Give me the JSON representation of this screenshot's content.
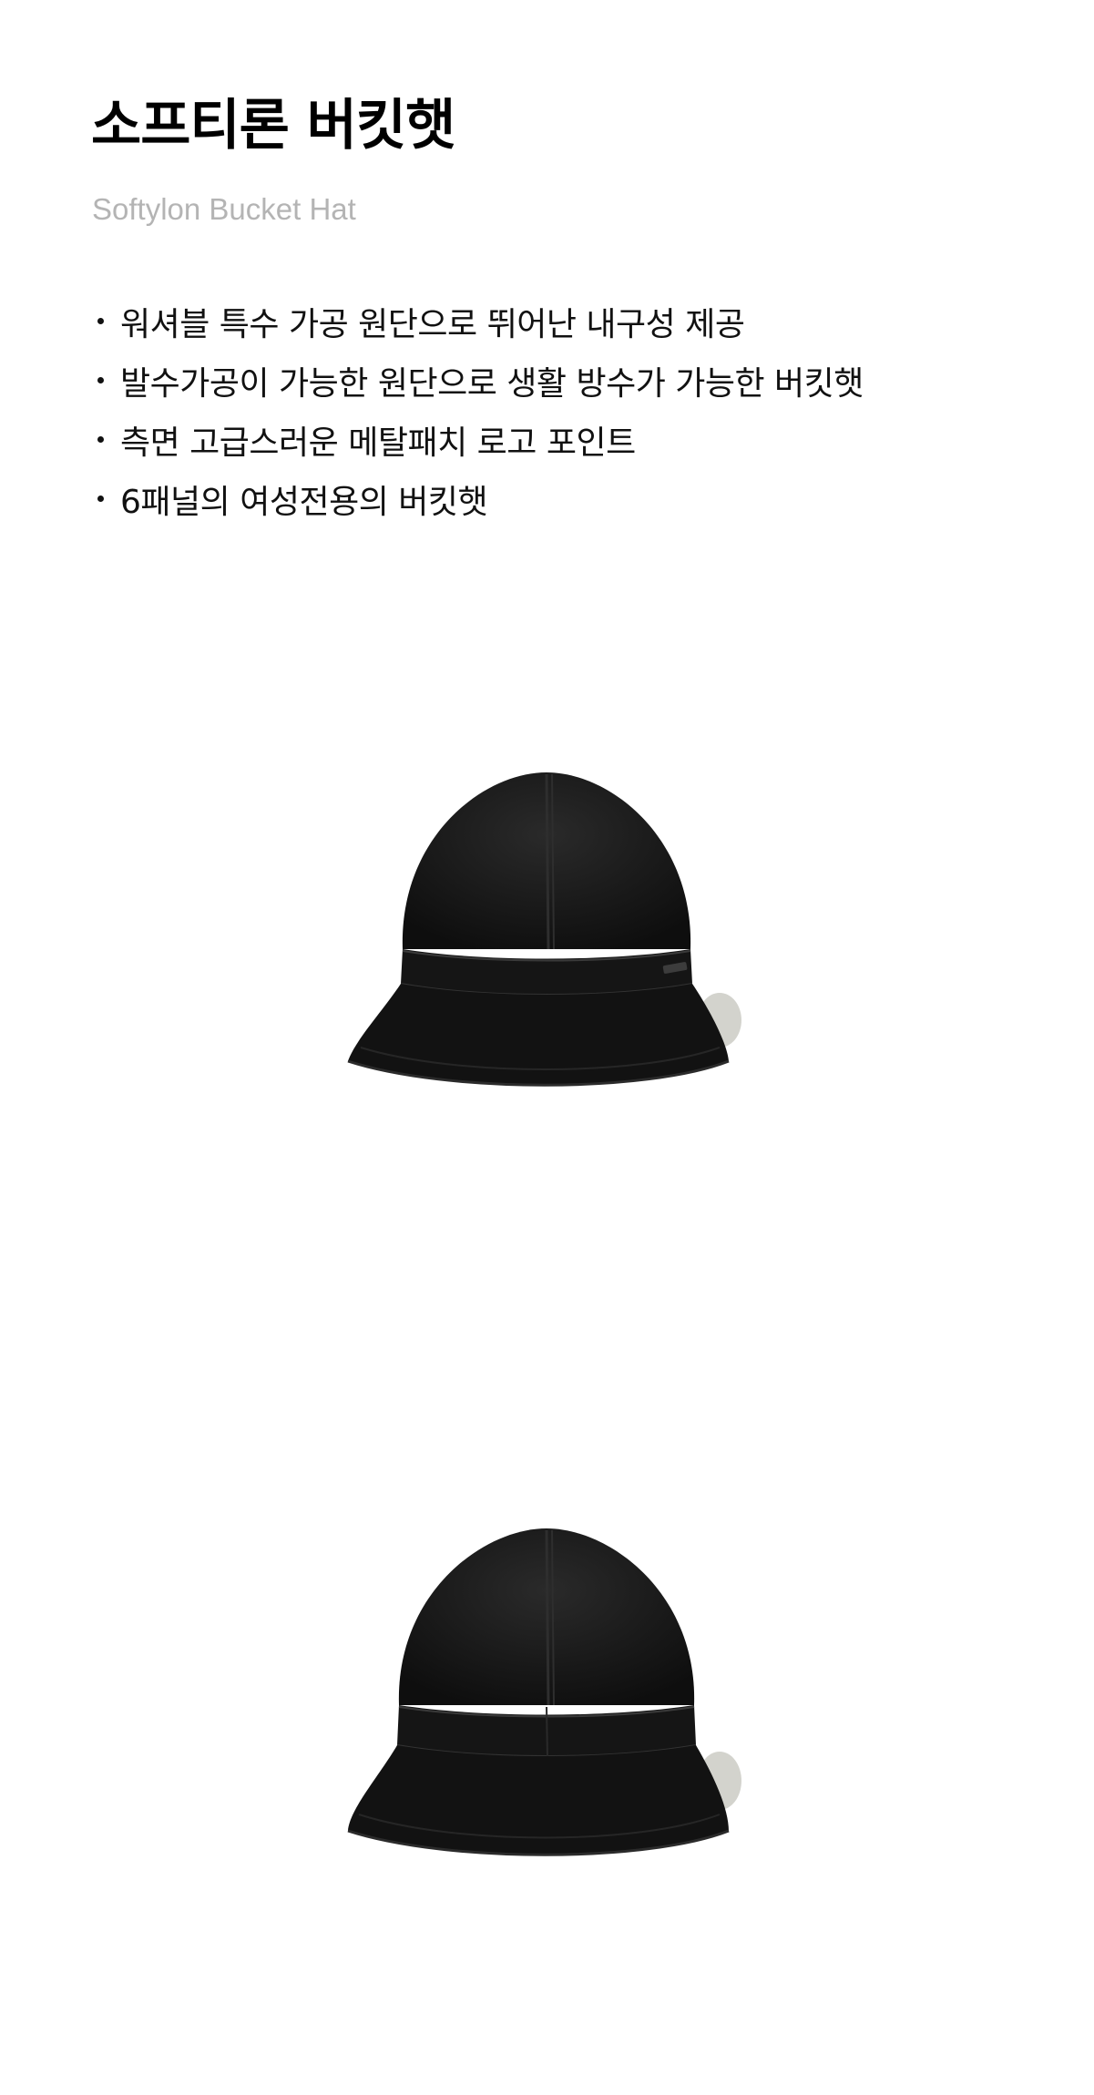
{
  "product": {
    "title": "소프티론 버킷햇",
    "subtitle": "Softylon Bucket Hat"
  },
  "features": [
    "워셔블 특수 가공 원단으로 뛰어난 내구성 제공",
    "발수가공이 가능한 원단으로 생활 방수가 가능한 버킷햇",
    "측면 고급스러운 메탈패치 로고 포인트",
    "6패널의 여성전용의 버킷햇"
  ],
  "images": [
    {
      "view": "front",
      "icon": "bucket-hat-front-photo",
      "color": "#141414"
    },
    {
      "view": "back",
      "icon": "bucket-hat-back-photo",
      "color": "#141414"
    }
  ]
}
